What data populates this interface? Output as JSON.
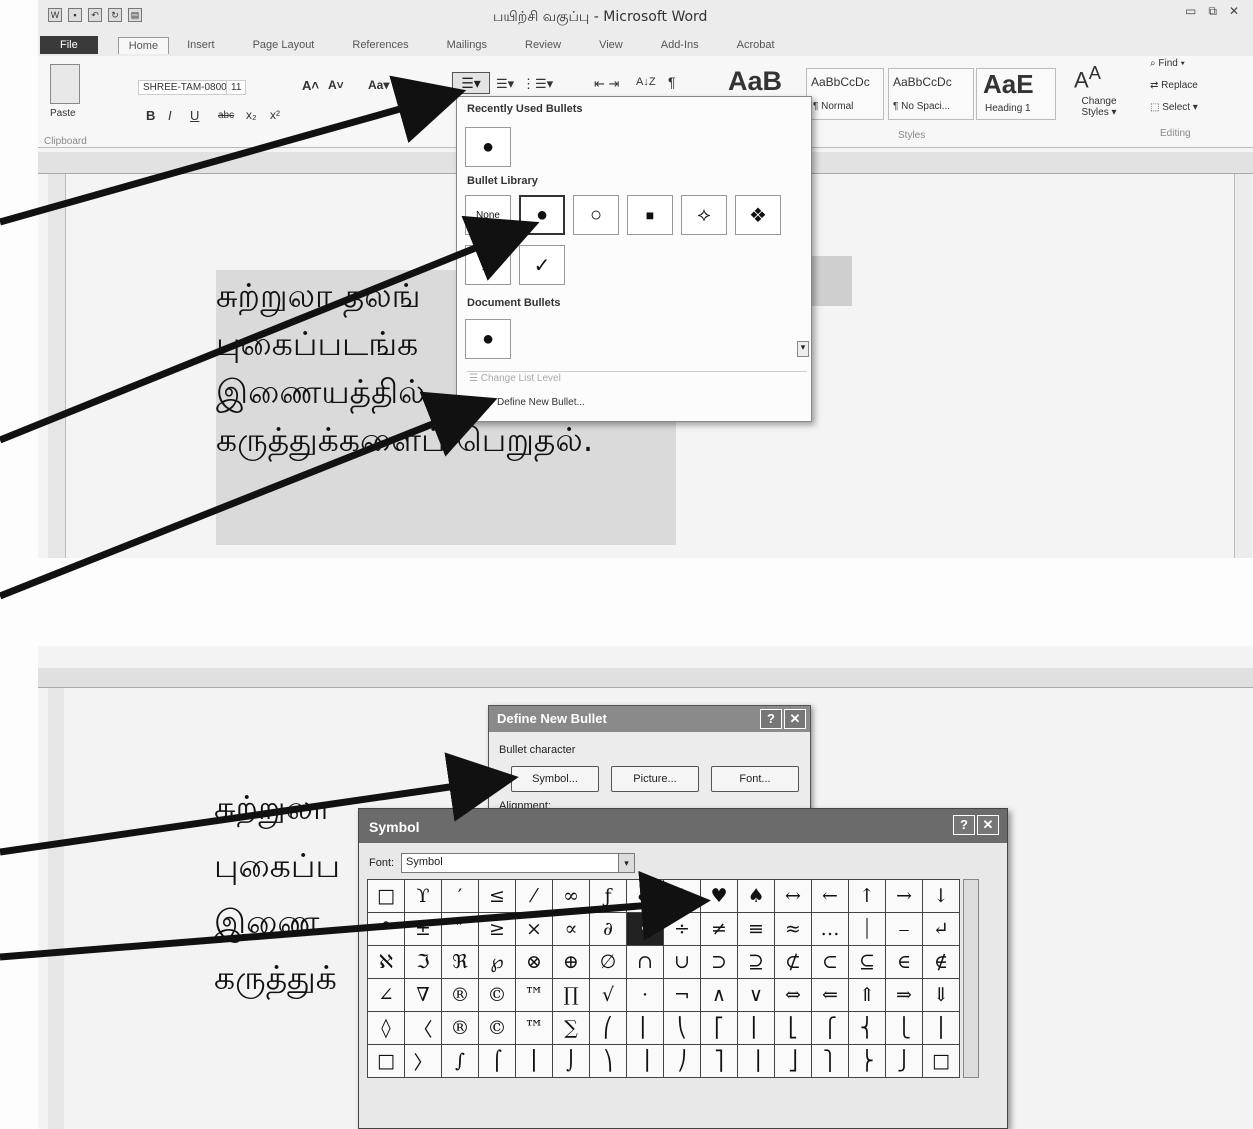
{
  "window": {
    "title": "பயிற்சி வகுப்பு - Microsoft Word",
    "controls": [
      "▭",
      "⧉",
      "✕"
    ]
  },
  "tabs": [
    "File",
    "Home",
    "Insert",
    "Page Layout",
    "References",
    "Mailings",
    "Review",
    "View",
    "Add-Ins",
    "Acrobat"
  ],
  "ribbon": {
    "paste_label": "Paste",
    "clipboard_label": "Clipboard",
    "font_name": "SHREE-TAM-0800",
    "font_size": "11",
    "grow_font": "A˄",
    "shrink_font": "A˅",
    "change_case": "Aa▾",
    "bold": "B",
    "italic": "I",
    "underline": "U",
    "strike": "abc",
    "subscript": "x₂",
    "superscript": "x²",
    "sort": "A↓Z",
    "pilcrow": "¶",
    "quick_style_big": "AaB",
    "styles": [
      {
        "preview": "AaBbCcDc",
        "label": "¶ Normal"
      },
      {
        "preview": "AaBbCcDc",
        "label": "¶ No Spaci..."
      },
      {
        "preview": "AaE",
        "label": "Heading 1"
      }
    ],
    "change_styles": "Change Styles ▾",
    "styles_group": "Styles",
    "find": "Find ▾",
    "replace": "Replace",
    "select": "Select ▾",
    "editing_group": "Editing"
  },
  "bullet_menu": {
    "recent_heading": "Recently Used Bullets",
    "library_heading": "Bullet Library",
    "document_heading": "Document Bullets",
    "none_label": "None",
    "recent_bullet": "●",
    "library_bullets": [
      "●",
      "○",
      "■",
      "⟡",
      "❖"
    ],
    "library_row2": [
      "➢",
      "✓"
    ],
    "document_bullet": "●",
    "change_list_level": "Change List Level",
    "define_new": "Define New Bullet..."
  },
  "document": {
    "lines": [
      "சுற்றுலா தலங்",
      "புகைப்படங்க",
      "இணையத்தில்",
      "கருத்துக்களைப் பெறுதல்."
    ]
  },
  "document2": {
    "lines": [
      "சுற்றுலா",
      "புகைப்ப",
      "இணை",
      "கருத்துக்"
    ]
  },
  "define_dialog": {
    "title": "Define New Bullet",
    "help": "?",
    "close": "✕",
    "bullet_character_label": "Bullet character",
    "symbol_button": "Symbol...",
    "picture_button": "Picture...",
    "font_button": "Font...",
    "alignment_label": "Alignment:"
  },
  "symbol_dialog": {
    "title": "Symbol",
    "help": "?",
    "close": "✕",
    "font_label": "Font:",
    "font_value": "Symbol",
    "rows": [
      [
        "□",
        "ϒ",
        "′",
        "≤",
        "⁄",
        "∞",
        "ƒ",
        "♣",
        "♦",
        "♥",
        "♠",
        "↔",
        "←",
        "↑",
        "→",
        "↓"
      ],
      [
        "°",
        "±",
        "″",
        "≥",
        "×",
        "∝",
        "∂",
        "•",
        "÷",
        "≠",
        "≡",
        "≈",
        "…",
        "⏐",
        "⎯",
        "↵"
      ],
      [
        "ℵ",
        "ℑ",
        "ℜ",
        "℘",
        "⊗",
        "⊕",
        "∅",
        "∩",
        "∪",
        "⊃",
        "⊇",
        "⊄",
        "⊂",
        "⊆",
        "∈",
        "∉"
      ],
      [
        "∠",
        "∇",
        "®",
        "©",
        "™",
        "∏",
        "√",
        "⋅",
        "¬",
        "∧",
        "∨",
        "⇔",
        "⇐",
        "⇑",
        "⇒",
        "⇓"
      ],
      [
        "◊",
        "〈",
        "®",
        "©",
        "™",
        "∑",
        "⎛",
        "⎜",
        "⎝",
        "⎡",
        "⎢",
        "⎣",
        "⎧",
        "⎨",
        "⎩",
        "⎪"
      ],
      [
        "□",
        "〉",
        "∫",
        "⌠",
        "⎮",
        "⌡",
        "⎞",
        "⎟",
        "⎠",
        "⎤",
        "⎥",
        "⎦",
        "⎫",
        "⎬",
        "⎭",
        "□"
      ]
    ],
    "selected": "•"
  }
}
